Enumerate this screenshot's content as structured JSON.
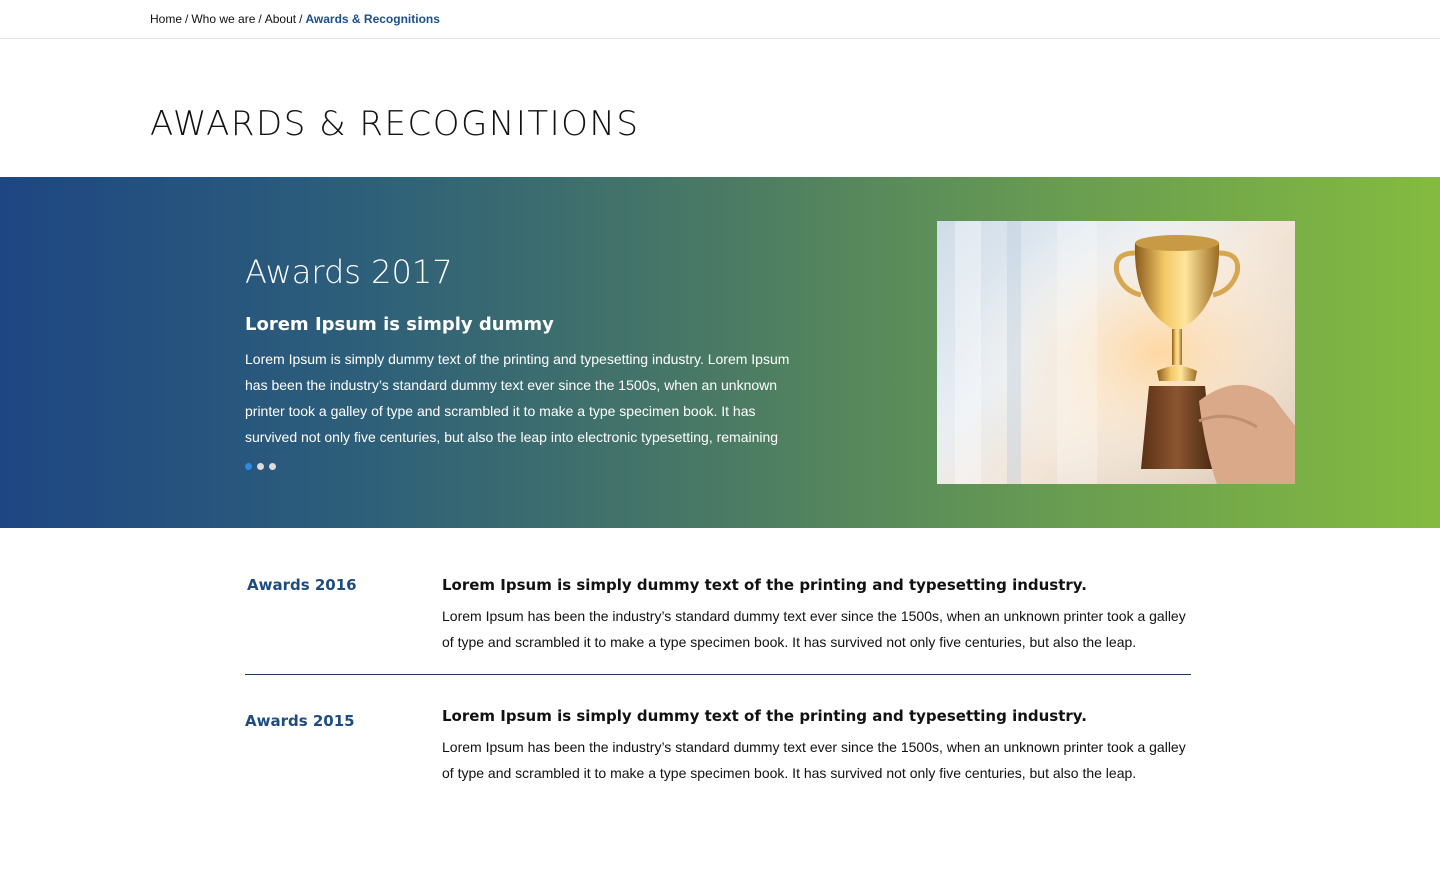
{
  "breadcrumb": {
    "items": [
      "Home",
      "Who we are",
      "About"
    ],
    "separator": "/",
    "current": "Awards & Recognitions"
  },
  "page": {
    "title": "AWARDS & RECOGNITIONS"
  },
  "hero": {
    "title": "Awards 2017",
    "subtitle": "Lorem Ipsum is simply dummy",
    "body": "Lorem Ipsum is simply dummy text of the printing and typesetting industry. Lorem Ipsum has been the industry’s standard dummy text ever since the 1500s, when an unknown printer took a galley of type and scrambled it to make a type specimen book. It has survived not only five centuries, but also the leap into electronic typesetting, remaining",
    "slides_total": 3,
    "active_slide": 1,
    "image": "trophy-photo",
    "colors": {
      "gradient_start": "#1e4683",
      "gradient_end": "#84bb3f",
      "active_dot": "#2f8ae6"
    }
  },
  "awards": [
    {
      "year": "Awards 2016",
      "heading": "Lorem Ipsum is simply dummy text of the printing and typesetting industry.",
      "text": "Lorem Ipsum has been the industry’s standard dummy text ever since the 1500s, when an unknown printer took a galley of type and scrambled it to make a type specimen book. It has survived not only five centuries, but also the leap."
    },
    {
      "year": "Awards 2015",
      "heading": "Lorem Ipsum is simply dummy text of the printing and typesetting industry.",
      "text": "Lorem Ipsum has been the industry’s standard dummy text ever since the 1500s, when an unknown printer took a galley of type and scrambled it to make a type specimen book. It has survived not only five centuries, but also the leap."
    }
  ],
  "colors": {
    "year_label": "#1f4c80",
    "breadcrumb_current": "#1b4f8e",
    "divider": "#1f3b5c"
  }
}
